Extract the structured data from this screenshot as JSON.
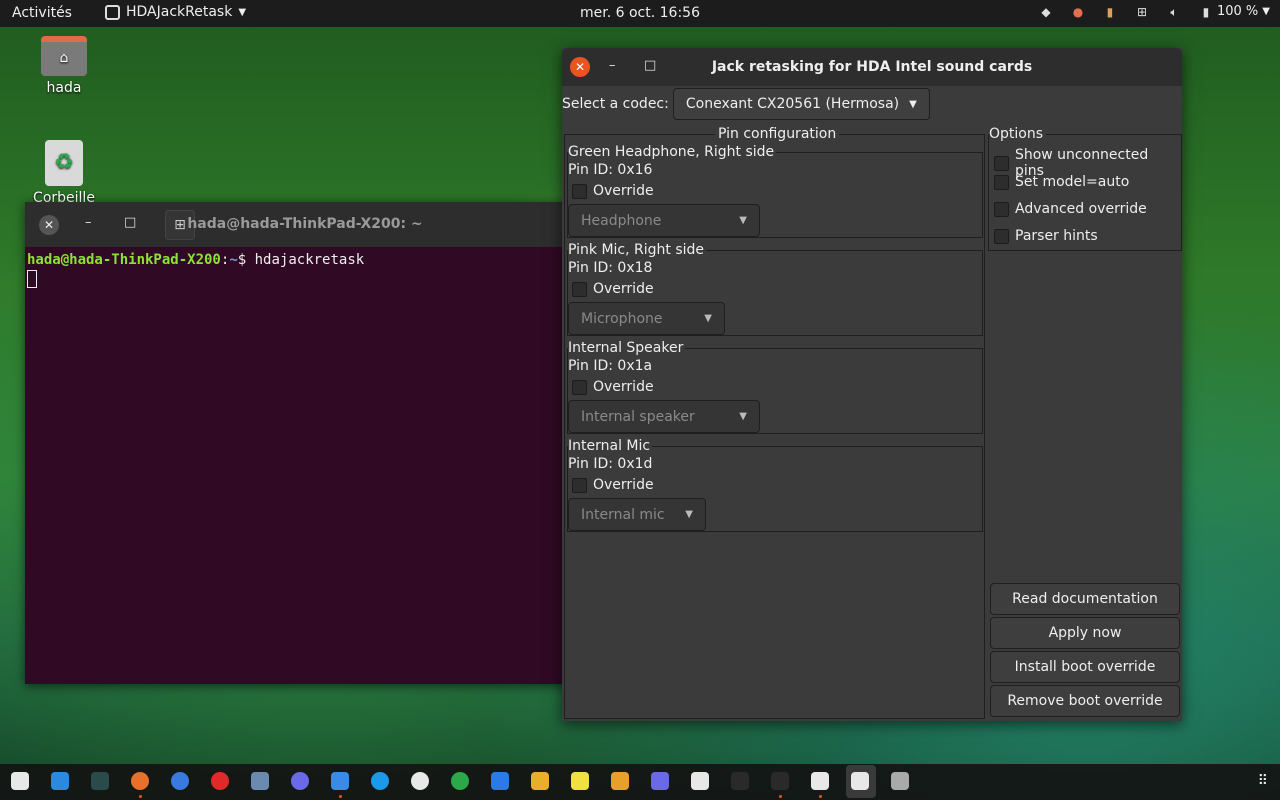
{
  "topbar": {
    "activities": "Activités",
    "app_menu": "HDAJackRetask",
    "clock": "mer. 6 oct.  16:56",
    "battery": "100 %"
  },
  "desktop": {
    "home_label": "hada",
    "trash_label": "Corbeille"
  },
  "terminal": {
    "title": "hada@hada-ThinkPad-X200: ~",
    "prompt_user": "hada@hada-ThinkPad-X200",
    "prompt_sep": ":",
    "prompt_path": "~",
    "prompt_symbol": "$",
    "command": " hdajackretask"
  },
  "hda": {
    "title": "Jack retasking for HDA Intel sound cards",
    "codec_label": "Select a codec:",
    "codec_value": "Conexant CX20561 (Hermosa)",
    "pin_config_label": "Pin configuration",
    "pins": [
      {
        "name": "Green Headphone, Right side",
        "id": "Pin ID: 0x16",
        "override": "Override",
        "select": "Headphone"
      },
      {
        "name": "Pink Mic, Right side",
        "id": "Pin ID: 0x18",
        "override": "Override",
        "select": "Microphone"
      },
      {
        "name": "Internal Speaker",
        "id": "Pin ID: 0x1a",
        "override": "Override",
        "select": "Internal speaker"
      },
      {
        "name": "Internal Mic",
        "id": "Pin ID: 0x1d",
        "override": "Override",
        "select": "Internal mic"
      }
    ],
    "options_label": "Options",
    "options": [
      "Show unconnected pins",
      "Set model=auto",
      "Advanced override",
      "Parser hints"
    ],
    "buttons": {
      "read_doc": "Read documentation",
      "apply": "Apply now",
      "install": "Install boot override",
      "remove": "Remove boot override"
    }
  },
  "dock": {
    "items": [
      "files-icon",
      "vscode-icon",
      "app-icon",
      "firefox-icon",
      "chrome-icon",
      "opera-icon",
      "browser-icon",
      "discord-icon",
      "app-icon",
      "skype-icon",
      "slack-icon",
      "yandex-icon",
      "zoom-icon",
      "app-icon",
      "notes-icon",
      "calculator-icon",
      "app-icon",
      "app-icon",
      "app-icon",
      "terminal-icon",
      "app-icon",
      "hda-icon",
      "app-icon"
    ],
    "colors": [
      "#e8e8e8",
      "#2a8ae0",
      "#2b4a4a",
      "#e8702a",
      "#3a7ae0",
      "#e02a2a",
      "#6a8ab0",
      "#6a6ae8",
      "#3a8ae8",
      "#1a9ae8",
      "#e8e8e8",
      "#2aa84a",
      "#2a7ae8",
      "#e8b02a",
      "#f0e040",
      "#e8a02a",
      "#6a6ae8",
      "#e8e8e8",
      "#2a2a2a",
      "#2a2a2a",
      "#e8e8e8",
      "#e8e8e8",
      "#aaaaaa"
    ]
  }
}
